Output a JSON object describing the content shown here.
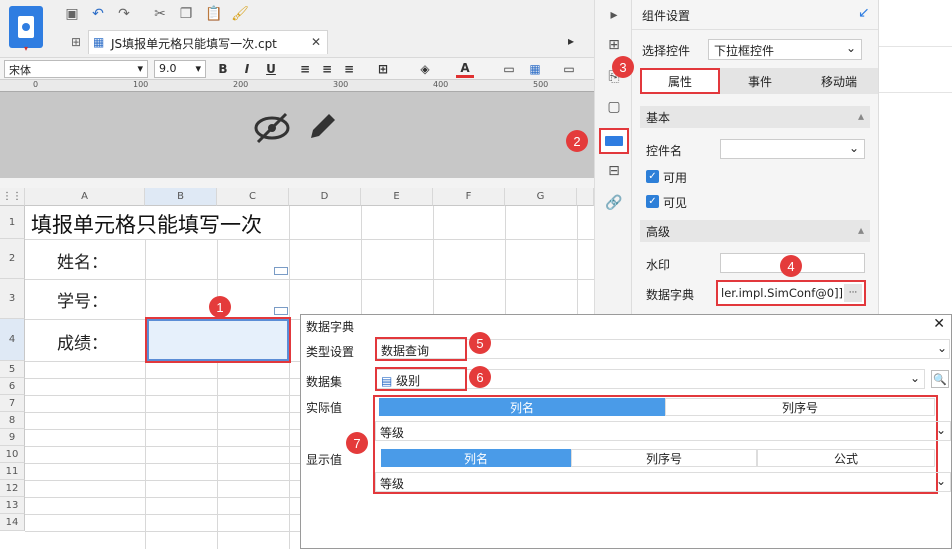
{
  "toolbar": {
    "tab_title": "JS填报单元格只能填写一次.cpt",
    "font_name": "宋体",
    "font_size": "9.0"
  },
  "ruler_ticks": [
    "0",
    "100",
    "200",
    "300",
    "400",
    "500"
  ],
  "grid": {
    "columns": [
      "A",
      "B",
      "C",
      "D",
      "E",
      "F",
      "G"
    ],
    "rows": [
      "1",
      "2",
      "3",
      "4",
      "5",
      "6",
      "7",
      "8",
      "9",
      "10",
      "11",
      "12",
      "13",
      "14"
    ],
    "title_cell": "填报单元格只能填写一次",
    "label_name": "姓名：",
    "label_id": "学号：",
    "label_score": "成绩："
  },
  "panel": {
    "title": "组件设置",
    "select_control_label": "选择控件",
    "select_control_value": "下拉框控件",
    "tabs": [
      "属性",
      "事件",
      "移动端"
    ],
    "section_basic": "基本",
    "control_name_label": "控件名",
    "enabled_label": "可用",
    "visible_label": "可见",
    "section_advanced": "高级",
    "watermark_label": "水印",
    "dict_label": "数据字典",
    "dict_value": "ler.impl.SimConf@0]]",
    "dict_more": "···"
  },
  "dialog": {
    "title": "数据字典",
    "type_label": "类型设置",
    "type_value": "数据查询",
    "dataset_label": "数据集",
    "dataset_value": "级别",
    "actual_label": "实际值",
    "actual_tabs": [
      "列名",
      "列序号"
    ],
    "actual_value": "等级",
    "display_label": "显示值",
    "display_tabs": [
      "列名",
      "列序号",
      "公式"
    ],
    "display_value": "等级"
  },
  "badges": [
    "1",
    "2",
    "3",
    "4",
    "5",
    "6",
    "7"
  ]
}
